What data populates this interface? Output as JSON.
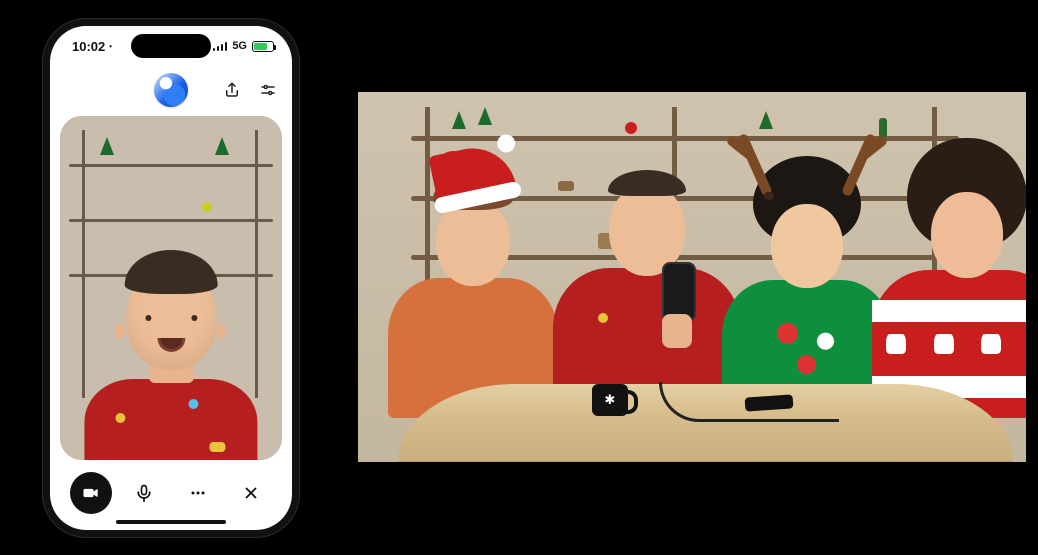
{
  "phone": {
    "statusbar": {
      "time": "10:02 ⸱",
      "network_label": "5G",
      "battery": {
        "percent": 72,
        "color": "#34c759"
      }
    },
    "topbar": {
      "share_icon": "share-icon",
      "settings_icon": "sliders-icon"
    },
    "controls": {
      "video_icon": "video-camera-icon",
      "mic_icon": "microphone-icon",
      "more_icon": "more-horizontal-icon",
      "close_icon": "close-icon"
    }
  },
  "colors": {
    "red_sweater": "#b61f1f",
    "orange_sweater": "#d6703c",
    "green_sweater": "#0d8f3e",
    "santa_red": "#c81e1e",
    "wood": "#725d44",
    "wall": "#cdbfa9",
    "table": "#e4cfa2"
  },
  "studio": {
    "people": [
      {
        "sweater": "orange",
        "hat": "santa"
      },
      {
        "sweater": "red-ornaments",
        "holding": "phone"
      },
      {
        "sweater": "green-holiday",
        "headband": "reindeer-antlers"
      },
      {
        "sweater": "red-santa-pattern"
      }
    ],
    "table_items": [
      "black-mug",
      "smartphone",
      "cable"
    ]
  }
}
